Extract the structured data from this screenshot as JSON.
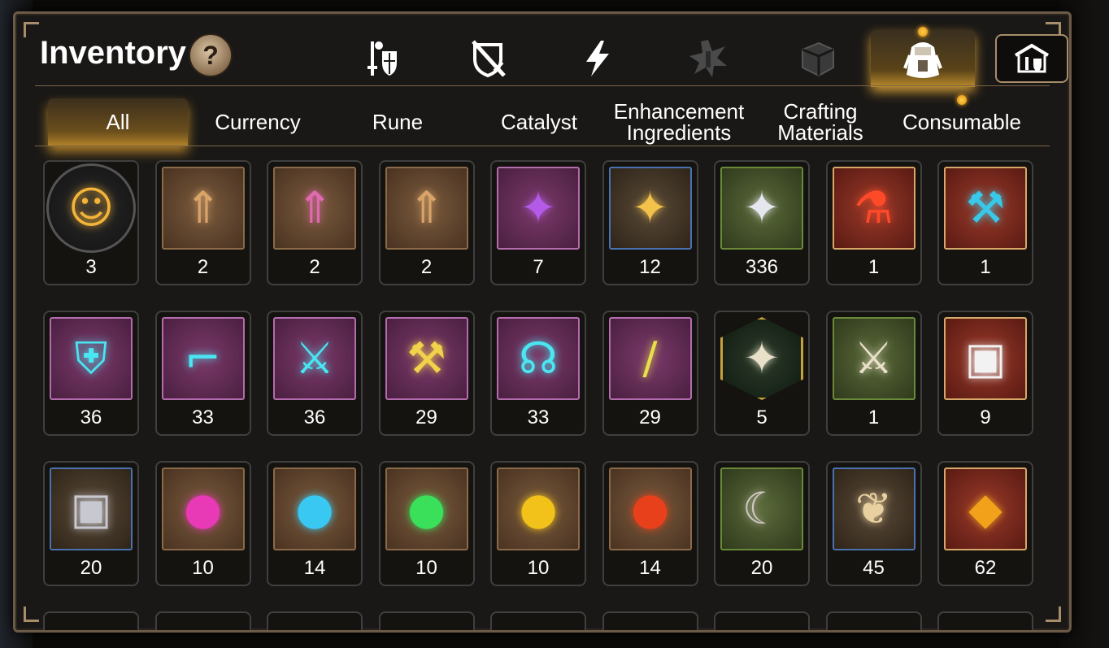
{
  "header": {
    "title": "Inventory",
    "help_label": "?"
  },
  "tab_icons": [
    {
      "name": "equipment-tab",
      "icon": "sword-shield-icon"
    },
    {
      "name": "unequipped-tab",
      "icon": "crossed-shield-icon"
    },
    {
      "name": "artifact-tab",
      "icon": "lightning-icon"
    },
    {
      "name": "rune-tab",
      "icon": "star-burst-icon"
    },
    {
      "name": "cube-tab",
      "icon": "cube-icon"
    },
    {
      "name": "bag-tab",
      "icon": "backpack-icon",
      "active": true
    },
    {
      "name": "storage-tab",
      "icon": "storage-house-icon"
    }
  ],
  "categories": [
    {
      "label": "All",
      "active": true
    },
    {
      "label": "Currency"
    },
    {
      "label": "Rune"
    },
    {
      "label": "Catalyst"
    },
    {
      "label": "Enhancement\nIngredients"
    },
    {
      "label": "Crafting\nMaterials"
    },
    {
      "label": "Consumable"
    }
  ],
  "items": [
    {
      "icon": "mascot-portrait-icon",
      "count": "3",
      "frame": "round"
    },
    {
      "icon": "scroll-upgrade-icon",
      "count": "2",
      "frame": "brown"
    },
    {
      "icon": "rainbow-scroll-upgrade-icon",
      "count": "2",
      "frame": "brown"
    },
    {
      "icon": "scroll-upgrade-icon",
      "count": "2",
      "frame": "brown"
    },
    {
      "icon": "purple-crystal-icon",
      "count": "7",
      "frame": "purple"
    },
    {
      "icon": "gold-crystal-icon",
      "count": "12",
      "frame": "blue"
    },
    {
      "icon": "silver-crystal-icon",
      "count": "336",
      "frame": "green"
    },
    {
      "icon": "red-potion-icon",
      "count": "1",
      "frame": "red"
    },
    {
      "icon": "hammer-stone-icon",
      "count": "1",
      "frame": "red"
    },
    {
      "icon": "armor-rune-icon",
      "count": "36",
      "frame": "purple"
    },
    {
      "icon": "boots-rune-icon",
      "count": "33",
      "frame": "purple"
    },
    {
      "icon": "sword-rune-icon",
      "count": "36",
      "frame": "purple"
    },
    {
      "icon": "hammer-rune-icon",
      "count": "29",
      "frame": "purple"
    },
    {
      "icon": "crest-rune-icon",
      "count": "33",
      "frame": "purple"
    },
    {
      "icon": "blade-rune-icon",
      "count": "29",
      "frame": "purple"
    },
    {
      "icon": "star-stone-icon",
      "count": "5",
      "frame": "hex"
    },
    {
      "icon": "blue-blade-stone-icon",
      "count": "1",
      "frame": "green"
    },
    {
      "icon": "silver-chest-icon",
      "count": "9",
      "frame": "red"
    },
    {
      "icon": "steel-chest-icon",
      "count": "20",
      "frame": "blue"
    },
    {
      "icon": "pink-gem-icon",
      "count": "10",
      "frame": "brown"
    },
    {
      "icon": "blue-gem-icon",
      "count": "14",
      "frame": "brown"
    },
    {
      "icon": "green-gem-icon",
      "count": "10",
      "frame": "brown"
    },
    {
      "icon": "yellow-gem-icon",
      "count": "10",
      "frame": "brown"
    },
    {
      "icon": "red-gem-icon",
      "count": "14",
      "frame": "brown"
    },
    {
      "icon": "claw-icon",
      "count": "20",
      "frame": "green"
    },
    {
      "icon": "ginseng-root-icon",
      "count": "45",
      "frame": "blue"
    },
    {
      "icon": "amber-shard-icon",
      "count": "62",
      "frame": "red"
    }
  ],
  "colors": {
    "accent_gold": "#c99636",
    "frame_purple": "#b36cad",
    "frame_blue": "#4a72b0",
    "frame_green": "#6a8a3a",
    "frame_red": "#d8a86a"
  }
}
